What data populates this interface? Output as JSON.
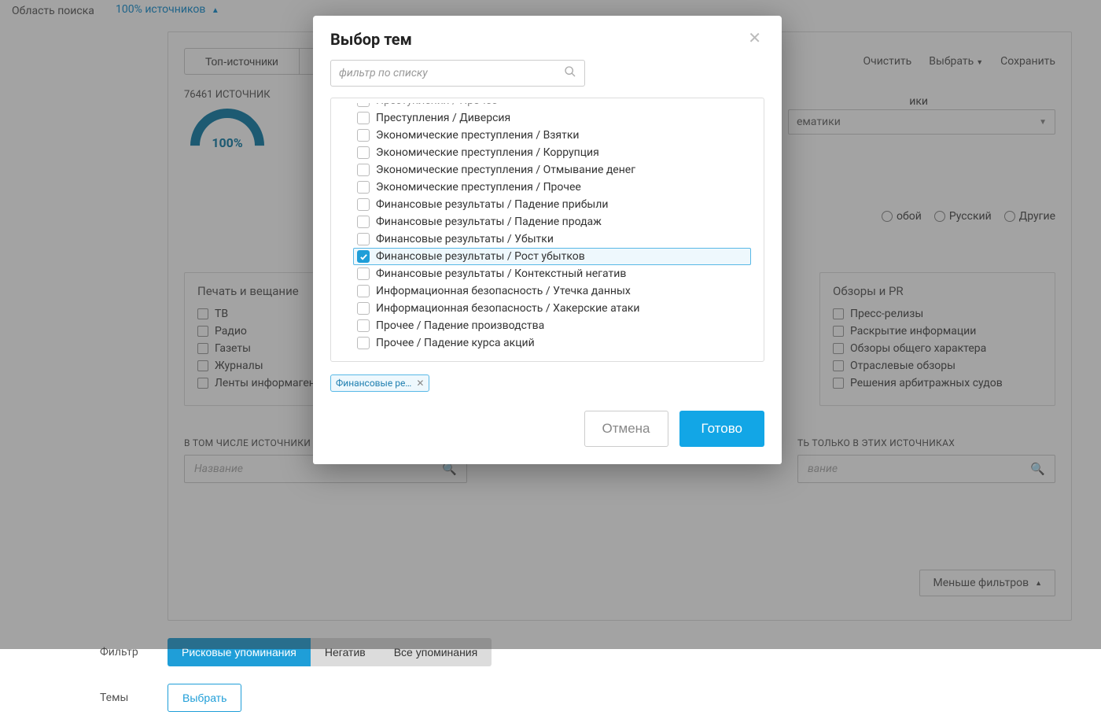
{
  "search": {
    "area_label": "Область поиска",
    "sources_link": "100% источников"
  },
  "toolbar": {
    "top_sources": "Топ-источники",
    "clear": "Очистить",
    "select": "Выбрать",
    "save": "Сохранить"
  },
  "stats": {
    "count_label": "76461 ИСТОЧНИК",
    "gauge_value": "100%",
    "theme_label_partial": "ики",
    "theme_select_partial": "ематики",
    "lang_opt_1": "обой",
    "lang_opt_2": "Русский",
    "lang_opt_3": "Другие"
  },
  "columns": {
    "left": {
      "title": "Печать и вещание",
      "items": [
        "ТВ",
        "Радио",
        "Газеты",
        "Журналы",
        "Ленты информагентств"
      ]
    },
    "right": {
      "title": "Обзоры и PR",
      "items": [
        "Пресс-релизы",
        "Раскрытие информации",
        "Обзоры общего характера",
        "Отраслевые обзоры",
        "Решения арбитражных судов"
      ]
    }
  },
  "sub": {
    "left_label": "В ТОМ ЧИСЛЕ ИСТОЧНИКИ",
    "right_label_partial": "ТЬ ТОЛЬКО В ЭТИХ ИСТОЧНИКАХ",
    "name_placeholder_left": "Название",
    "name_placeholder_right": "вание"
  },
  "panel_foot": {
    "less_filters": "Меньше фильтров"
  },
  "below": {
    "filter_label": "Фильтр",
    "pills": [
      "Рисковые упоминания",
      "Негатив",
      "Все упоминания"
    ],
    "themes_label": "Темы",
    "choose": "Выбрать"
  },
  "modal": {
    "title": "Выбор тем",
    "filter_placeholder": "фильтр по списку",
    "cancel": "Отмена",
    "done": "Готово",
    "chip_label": "Финансовые ре…",
    "items": [
      {
        "label": "Преступления / Прочее",
        "checked": false,
        "cut": true
      },
      {
        "label": "Преступления / Диверсия",
        "checked": false
      },
      {
        "label": "Экономические преступления / Взятки",
        "checked": false
      },
      {
        "label": "Экономические преступления / Коррупция",
        "checked": false
      },
      {
        "label": "Экономические преступления / Отмывание денег",
        "checked": false
      },
      {
        "label": "Экономические преступления / Прочее",
        "checked": false
      },
      {
        "label": "Финансовые результаты / Падение прибыли",
        "checked": false
      },
      {
        "label": "Финансовые результаты / Падение продаж",
        "checked": false
      },
      {
        "label": "Финансовые результаты / Убытки",
        "checked": false
      },
      {
        "label": "Финансовые результаты / Рост убытков",
        "checked": true
      },
      {
        "label": "Финансовые результаты / Контекстный негатив",
        "checked": false
      },
      {
        "label": "Информационная безопасность / Утечка данных",
        "checked": false
      },
      {
        "label": "Информационная безопасность / Хакерские атаки",
        "checked": false
      },
      {
        "label": "Прочее / Падение производства",
        "checked": false
      },
      {
        "label": "Прочее / Падение курса акций",
        "checked": false
      }
    ]
  }
}
